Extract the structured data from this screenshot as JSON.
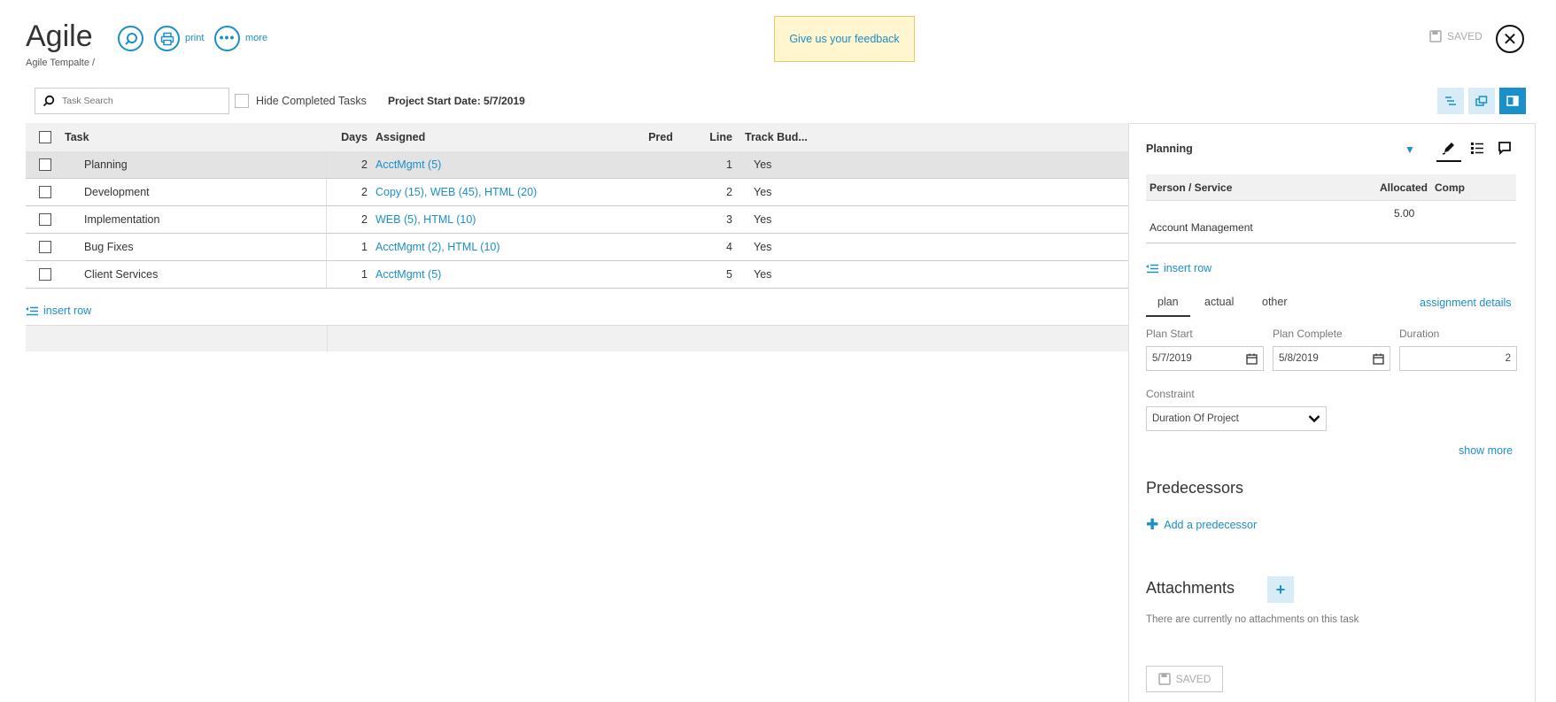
{
  "header": {
    "title": "Agile",
    "breadcrumb": "Agile Tempalte /",
    "print_label": "print",
    "more_label": "more",
    "feedback_label": "Give us your feedback",
    "saved_label": "SAVED"
  },
  "toolbar": {
    "search_placeholder": "Task Search",
    "hide_completed_label": "Hide Completed Tasks",
    "project_start_date": "Project Start Date: 5/7/2019"
  },
  "grid": {
    "columns": {
      "task": "Task",
      "days": "Days",
      "assigned": "Assigned",
      "pred": "Pred",
      "line": "Line",
      "track": "Track Bud..."
    },
    "rows": [
      {
        "task": "Planning",
        "days": "2",
        "assigned": "AcctMgmt (5)",
        "pred": "",
        "line": "1",
        "track": "Yes"
      },
      {
        "task": "Development",
        "days": "2",
        "assigned": "Copy (15), WEB (45), HTML (20)",
        "pred": "",
        "line": "2",
        "track": "Yes"
      },
      {
        "task": "Implementation",
        "days": "2",
        "assigned": "WEB (5), HTML (10)",
        "pred": "",
        "line": "3",
        "track": "Yes"
      },
      {
        "task": "Bug Fixes",
        "days": "1",
        "assigned": "AcctMgmt (2), HTML (10)",
        "pred": "",
        "line": "4",
        "track": "Yes"
      },
      {
        "task": "Client Services",
        "days": "1",
        "assigned": "AcctMgmt (5)",
        "pred": "",
        "line": "5",
        "track": "Yes"
      }
    ],
    "insert_row_label": "insert row"
  },
  "panel": {
    "title": "Planning",
    "table_headers": {
      "person": "Person / Service",
      "allocated": "Allocated",
      "comp": "Comp"
    },
    "row": {
      "person": "Account Management",
      "allocated": "5.00",
      "comp": ""
    },
    "insert_row_label": "insert row",
    "tabs": [
      "plan",
      "actual",
      "other"
    ],
    "assignment_details_label": "assignment details",
    "plan_start_label": "Plan Start",
    "plan_start_value": "5/7/2019",
    "plan_complete_label": "Plan Complete",
    "plan_complete_value": "5/8/2019",
    "duration_label": "Duration",
    "duration_value": "2",
    "constraint_label": "Constraint",
    "constraint_value": "Duration Of Project",
    "show_more_label": "show more",
    "predecessors_heading": "Predecessors",
    "add_predecessor_label": "Add a predecessor",
    "attachments_heading": "Attachments",
    "no_attachments_text": "There are currently no attachments on this task",
    "saved_label": "SAVED"
  },
  "colors": {
    "accent": "#1a8fc9",
    "feedback_bg": "#fff6cf"
  }
}
